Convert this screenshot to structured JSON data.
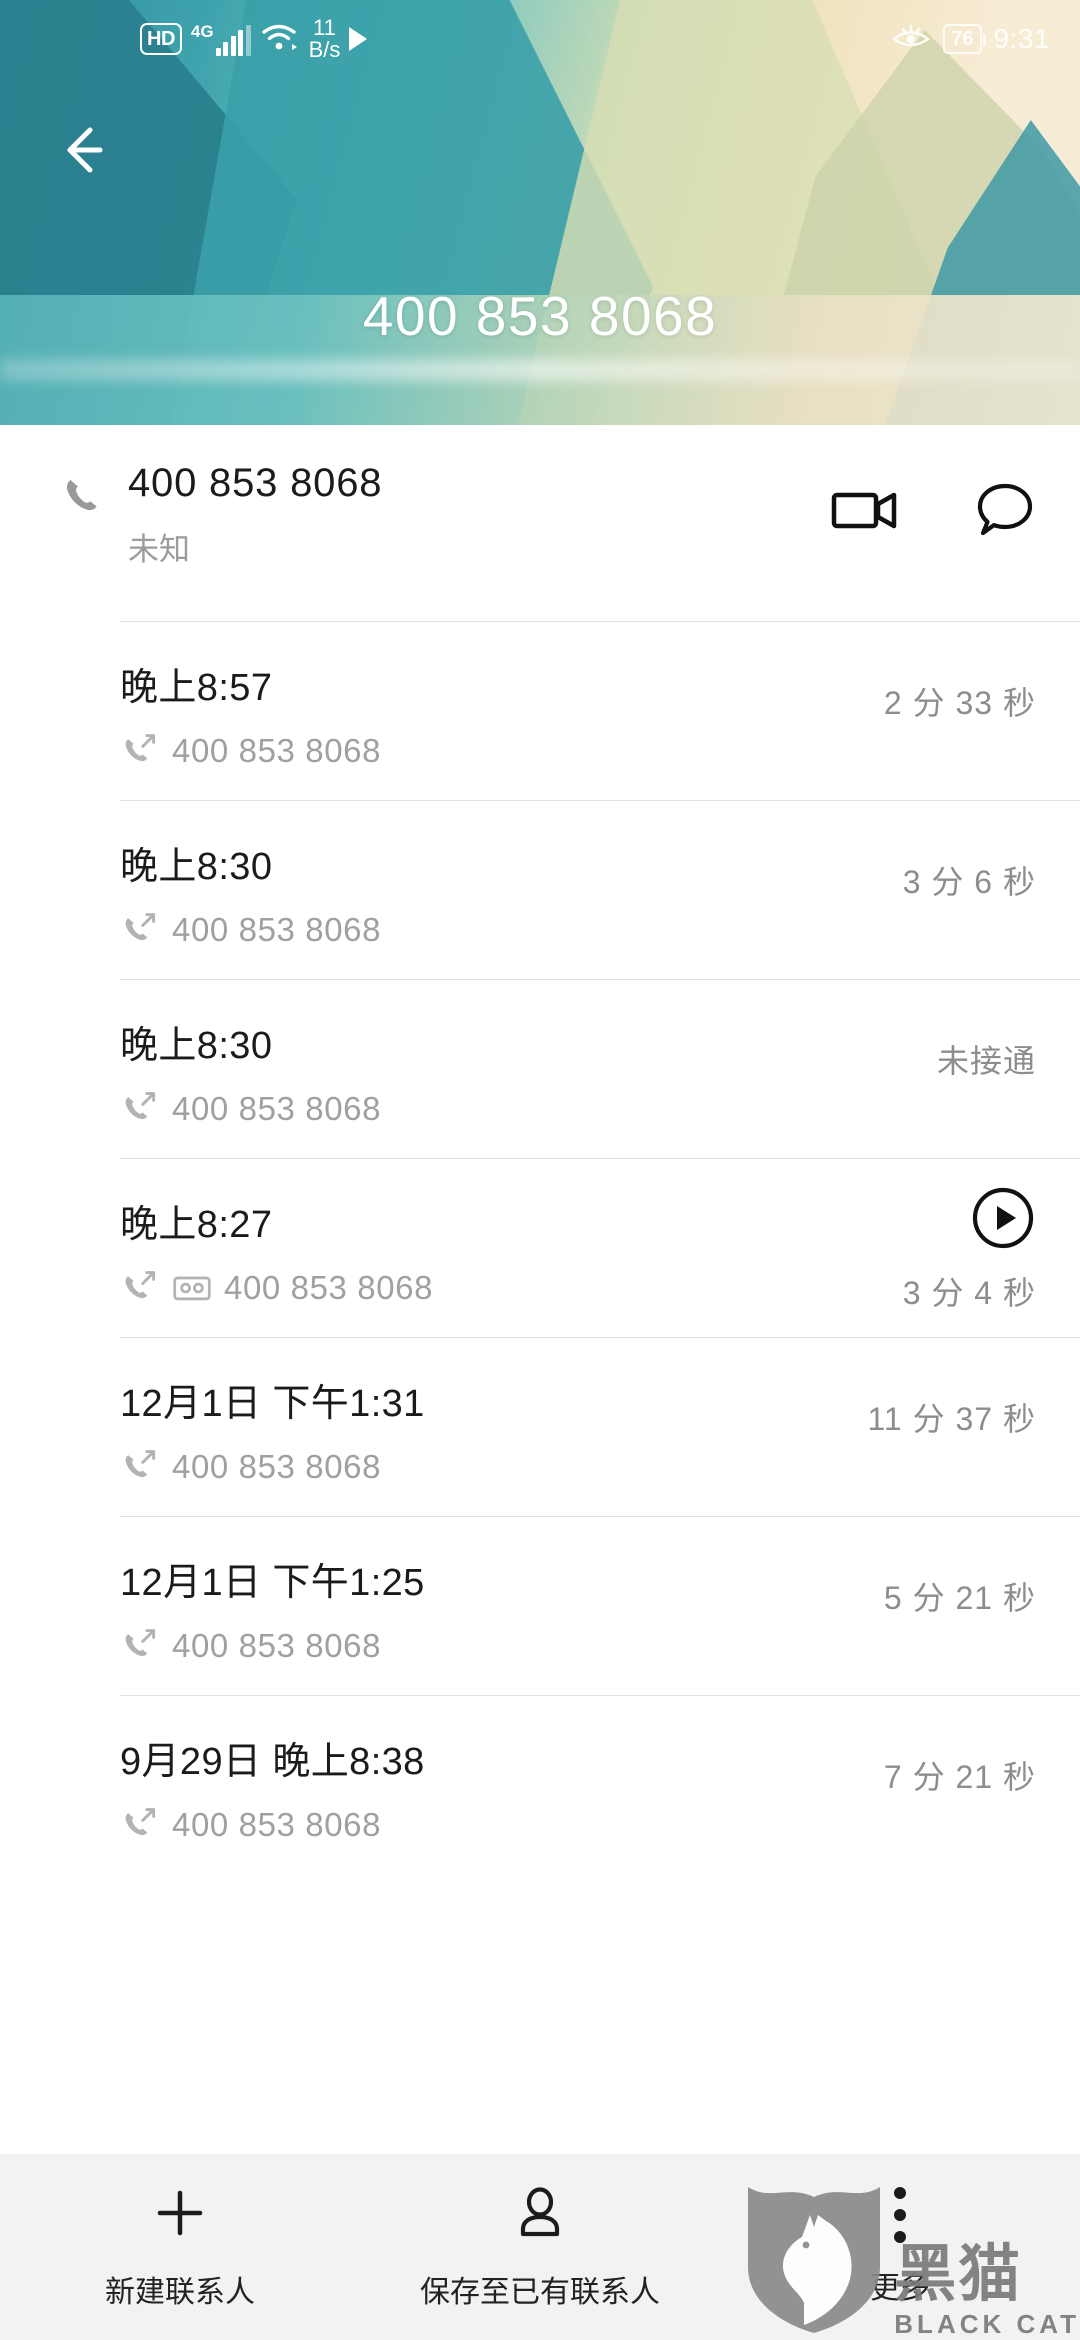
{
  "status_bar": {
    "hd_label": "HD",
    "network_type": "4G",
    "net_speed_value": "11",
    "net_speed_unit": "B/s",
    "wifi_icon": "wifi-icon",
    "signal_icon": "signal-bars-icon",
    "play_icon": "play-triangle-icon",
    "eye_comfort_icon": "eye-comfort-icon",
    "battery_level": "76",
    "time": "9:31"
  },
  "header": {
    "back_icon": "back-arrow-icon",
    "title": "400 853 8068",
    "accent_color": "#3fa3ad",
    "banner_light": "#f6ecd6"
  },
  "contact": {
    "phone_icon": "phone-handset-icon",
    "number": "400 853 8068",
    "label": "未知",
    "video_call_icon": "video-camera-icon",
    "message_icon": "message-bubble-icon"
  },
  "call_log": [
    {
      "time": "晚上8:57",
      "direction_icon": "outgoing-call-icon",
      "number": "400 853 8068",
      "duration": "2 分 33 秒",
      "has_recording": false,
      "has_play_button": false
    },
    {
      "time": "晚上8:30",
      "direction_icon": "outgoing-call-icon",
      "number": "400 853 8068",
      "duration": "3 分 6 秒",
      "has_recording": false,
      "has_play_button": false
    },
    {
      "time": "晚上8:30",
      "direction_icon": "outgoing-call-icon",
      "number": "400 853 8068",
      "duration": "未接通",
      "has_recording": false,
      "has_play_button": false
    },
    {
      "time": "晚上8:27",
      "direction_icon": "outgoing-call-icon",
      "number": "400 853 8068",
      "duration": "3 分 4 秒",
      "has_recording": true,
      "recording_icon": "voice-recording-icon",
      "has_play_button": true,
      "play_icon": "play-circle-icon"
    },
    {
      "time": "12月1日 下午1:31",
      "direction_icon": "outgoing-call-icon",
      "number": "400 853 8068",
      "duration": "11 分 37 秒",
      "has_recording": false,
      "has_play_button": false
    },
    {
      "time": "12月1日 下午1:25",
      "direction_icon": "outgoing-call-icon",
      "number": "400 853 8068",
      "duration": "5 分 21 秒",
      "has_recording": false,
      "has_play_button": false
    },
    {
      "time": "9月29日 晚上8:38",
      "direction_icon": "outgoing-call-icon",
      "number": "400 853 8068",
      "duration": "7 分 21 秒",
      "has_recording": false,
      "has_play_button": false
    }
  ],
  "bottom_bar": [
    {
      "icon": "plus-icon",
      "label": "新建联系人"
    },
    {
      "icon": "person-icon",
      "label": "保存至已有联系人"
    },
    {
      "icon": "more-dots-icon",
      "label": "更多"
    }
  ],
  "watermark": {
    "cn": "黑猫",
    "en": "BLACK CAT",
    "shield_icon": "black-cat-shield-icon"
  }
}
